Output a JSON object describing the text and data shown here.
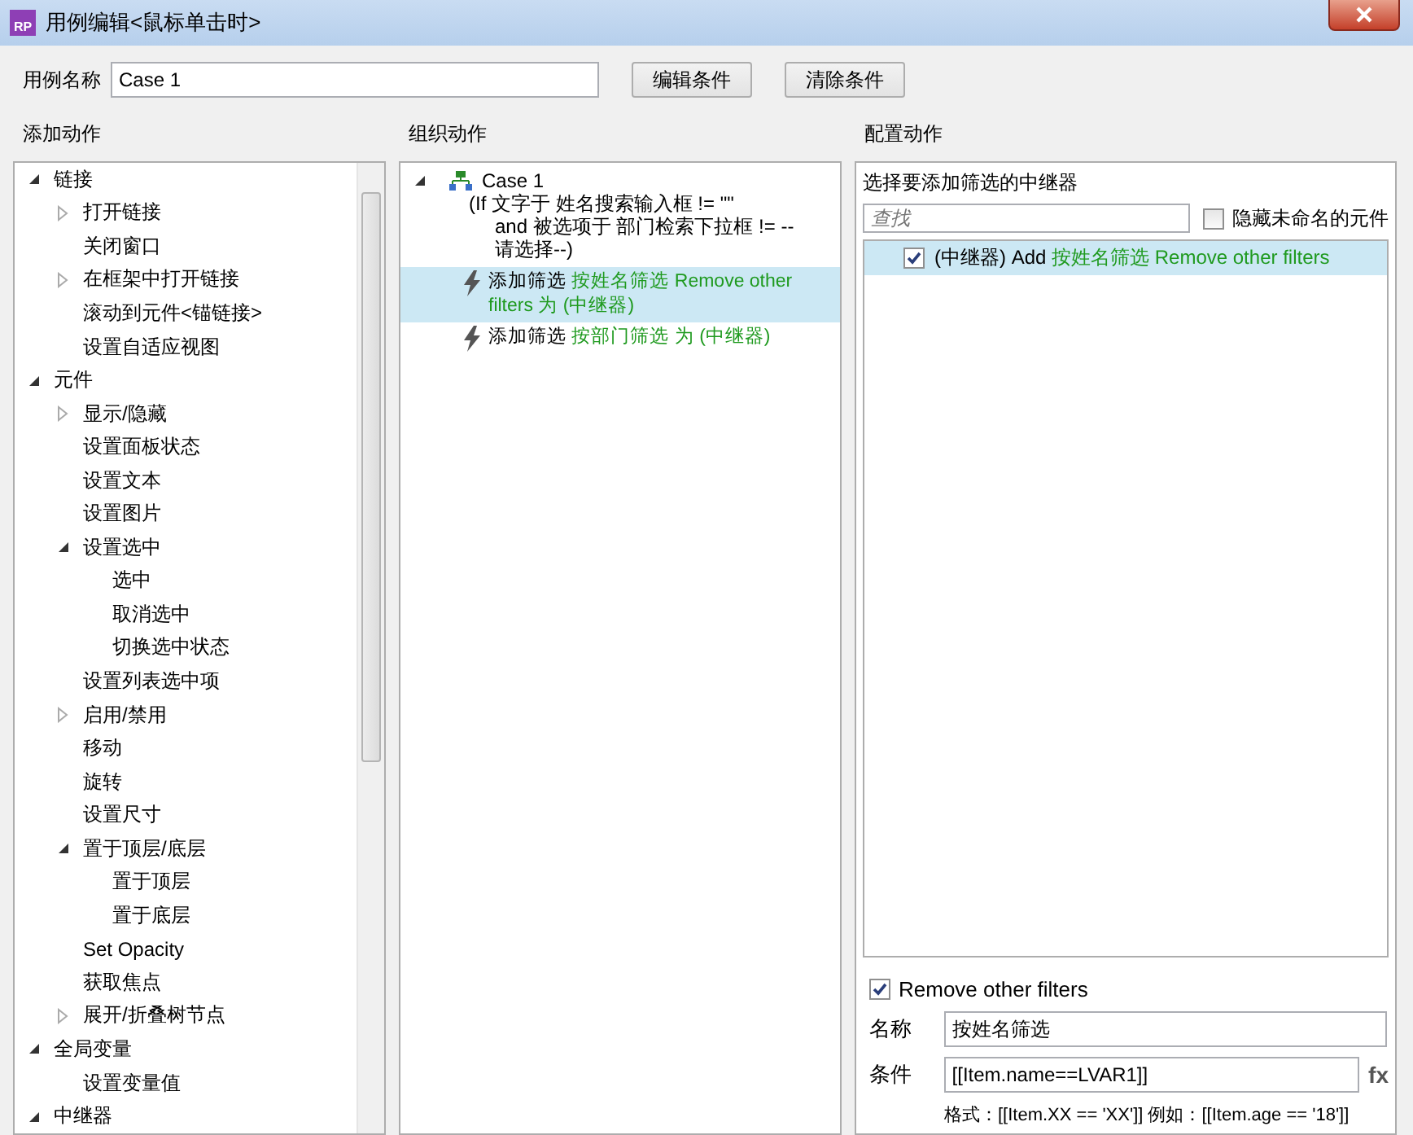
{
  "window": {
    "icon_text": "RP",
    "title": "用例编辑<鼠标单击时>"
  },
  "case_name": {
    "label": "用例名称",
    "value": "Case 1"
  },
  "buttons": [
    "编辑条件",
    "清除条件"
  ],
  "add_actions": {
    "heading": "添加动作",
    "tree": [
      {
        "label": "链接",
        "expanded": true,
        "children": [
          {
            "label": "打开链接",
            "expanded": false
          },
          {
            "label": "关闭窗口"
          },
          {
            "label": "在框架中打开链接",
            "expanded": false
          },
          {
            "label": "滚动到元件<锚链接>"
          },
          {
            "label": "设置自适应视图"
          }
        ]
      },
      {
        "label": "元件",
        "expanded": true,
        "children": [
          {
            "label": "显示/隐藏",
            "expanded": false
          },
          {
            "label": "设置面板状态"
          },
          {
            "label": "设置文本"
          },
          {
            "label": "设置图片"
          },
          {
            "label": "设置选中",
            "expanded": true,
            "children": [
              {
                "label": "选中"
              },
              {
                "label": "取消选中"
              },
              {
                "label": "切换选中状态"
              }
            ]
          },
          {
            "label": "设置列表选中项"
          },
          {
            "label": "启用/禁用",
            "expanded": false
          },
          {
            "label": "移动"
          },
          {
            "label": "旋转"
          },
          {
            "label": "设置尺寸"
          },
          {
            "label": "置于顶层/底层",
            "expanded": true,
            "children": [
              {
                "label": "置于顶层"
              },
              {
                "label": "置于底层"
              }
            ]
          },
          {
            "label": "Set Opacity"
          },
          {
            "label": "获取焦点"
          },
          {
            "label": "展开/折叠树节点",
            "expanded": false
          }
        ]
      },
      {
        "label": "全局变量",
        "expanded": true,
        "children": [
          {
            "label": "设置变量值"
          }
        ]
      },
      {
        "label": "中继器",
        "expanded": true
      }
    ]
  },
  "organize_actions": {
    "heading": "组织动作",
    "case": {
      "label": "Case 1",
      "expanded": true,
      "condition": [
        "(If 文字于 姓名搜索输入框 != \"\"",
        "and 被选项于 部门检索下拉框 != --请选择--)"
      ],
      "actions": [
        {
          "verb": "添加筛选",
          "target": "按姓名筛选 Remove other filters 为 (中继器)",
          "selected": true
        },
        {
          "verb": "添加筛选",
          "target": "按部门筛选 为 (中继器)",
          "selected": false
        }
      ]
    }
  },
  "configure_actions": {
    "heading": "配置动作",
    "subheading": "选择要添加筛选的中继器",
    "search": {
      "placeholder": "查找"
    },
    "hide_unnamed": {
      "label": "隐藏未命名的元件",
      "checked": false
    },
    "repeaters": [
      {
        "prefix": "(中继器) Add",
        "filter": "按姓名筛选 Remove other filters",
        "checked": true,
        "selected": true
      }
    ],
    "remove_other_filters": {
      "label": "Remove other filters",
      "checked": true
    },
    "name": {
      "label": "名称",
      "value": "按姓名筛选"
    },
    "condition": {
      "label": "条件",
      "value": "[[Item.name==LVAR1]]",
      "fx": "fx",
      "hint": "格式：[[Item.XX == 'XX']] 例如：[[Item.age == '18']]"
    }
  }
}
